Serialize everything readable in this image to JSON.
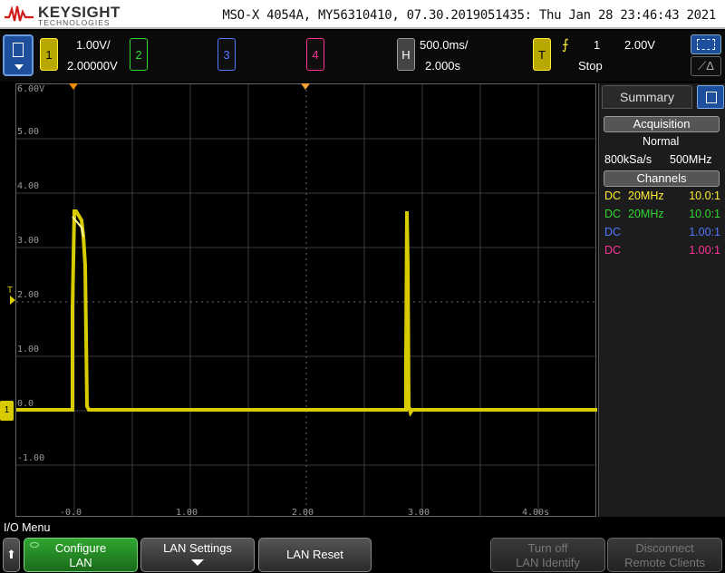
{
  "brand": {
    "name": "KEYSIGHT",
    "sub": "TECHNOLOGIES"
  },
  "header": {
    "info": "MSO-X 4054A, MY56310410, 07.30.2019051435: Thu Jan 28 23:46:43 2021"
  },
  "channels": {
    "ch1": {
      "label": "1",
      "volts_per_div": "1.00V/",
      "offset": "2.00000V",
      "color": "#ffee33"
    },
    "ch2": {
      "label": "2",
      "color": "#33d633"
    },
    "ch3": {
      "label": "3",
      "color": "#5577ff"
    },
    "ch4": {
      "label": "4",
      "color": "#ff3399"
    }
  },
  "horizontal": {
    "label": "H",
    "time_per_div": "500.0ms/",
    "delay": "2.000s"
  },
  "trigger": {
    "label": "T",
    "slope_icon": "rising-edge",
    "slope_glyph": "⨍",
    "source": "1",
    "level": "2.00V",
    "state": "Stop"
  },
  "grid": {
    "y_labels": [
      "6.00V",
      "5.00",
      "4.00",
      "3.00",
      "2.00",
      "1.00",
      "0.0",
      "-1.00"
    ],
    "x_labels": [
      "-0.0",
      "1.00",
      "2.00",
      "3.00",
      "4.00s"
    ],
    "ground_marker": "1",
    "trigger_marker": "T"
  },
  "panel": {
    "tab": "Summary",
    "acquisition_head": "Acquisition",
    "acq_mode": "Normal",
    "sample_rate": "800kSa/s",
    "bandwidth": "500MHz",
    "channels_head": "Channels",
    "rows": [
      {
        "coupling": "DC",
        "bw": "20MHz",
        "probe": "10.0:1",
        "color": "#ffee33"
      },
      {
        "coupling": "DC",
        "bw": "20MHz",
        "probe": "10.0:1",
        "color": "#33d633"
      },
      {
        "coupling": "DC",
        "bw": "",
        "probe": "1.00:1",
        "color": "#5577ff"
      },
      {
        "coupling": "DC",
        "bw": "",
        "probe": "1.00:1",
        "color": "#ff3399"
      }
    ]
  },
  "menu": {
    "title": "I/O Menu",
    "back_glyph": "⬆",
    "configure_l1": "Configure",
    "configure_l2": "LAN",
    "lan_settings": "LAN Settings",
    "lan_reset": "LAN Reset",
    "identify_l1": "Turn off",
    "identify_l2": "LAN Identify",
    "disconnect_l1": "Disconnect",
    "disconnect_l2": "Remote Clients"
  }
}
